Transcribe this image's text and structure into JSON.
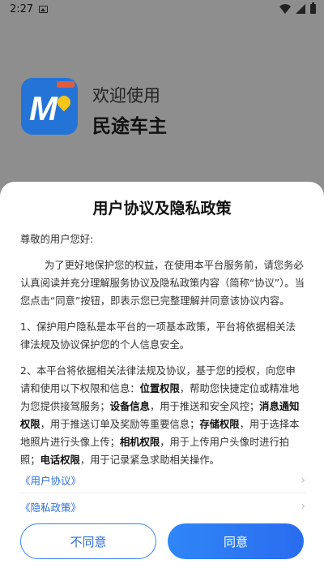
{
  "status_bar": {
    "time": "2:27"
  },
  "splash": {
    "welcome": "欢迎使用",
    "app_name": "民途车主"
  },
  "dialog": {
    "title": "用户协议及隐私政策",
    "greeting": "尊敬的用户您好:",
    "intro": "为了更好地保护您的权益，在使用本平台服务前，请您务必认真阅读并充分理解服务协议及隐私政策内容（简称“协议”）。当您点击“同意”按钮，即表示您已完整理解并同意该协议内容。",
    "point1": "1、保护用户隐私是本平台的一项基本政策，平台将依据相关法律法规及协议保护您的个人信息安全。",
    "point2": {
      "p0": "2、本平台将依据相关法律法规及协议，基于您的授权，向您申请和使用以下权限和信息：",
      "b1": "位置权限",
      "p1": "，帮助您快捷定位或精准地为您提供接驾服务；",
      "b2": "设备信息",
      "p2": "，用于推送和安全风控；",
      "b3": "消息通知权限",
      "p3": "，用于推送订单及奖励等重要信息；",
      "b4": "存储权限",
      "p4": "，用于选择本地照片进行头像上传；",
      "b5": "相机权限",
      "p5": "，用于上传用户头像时进行拍照；",
      "b6": "电话权限",
      "p6": "，用于记录紧急求助相关操作。"
    },
    "links": {
      "user_agreement": "《用户协议》",
      "privacy_policy": "《隐私政策》"
    },
    "buttons": {
      "disagree": "不同意",
      "agree": "同意"
    }
  }
}
